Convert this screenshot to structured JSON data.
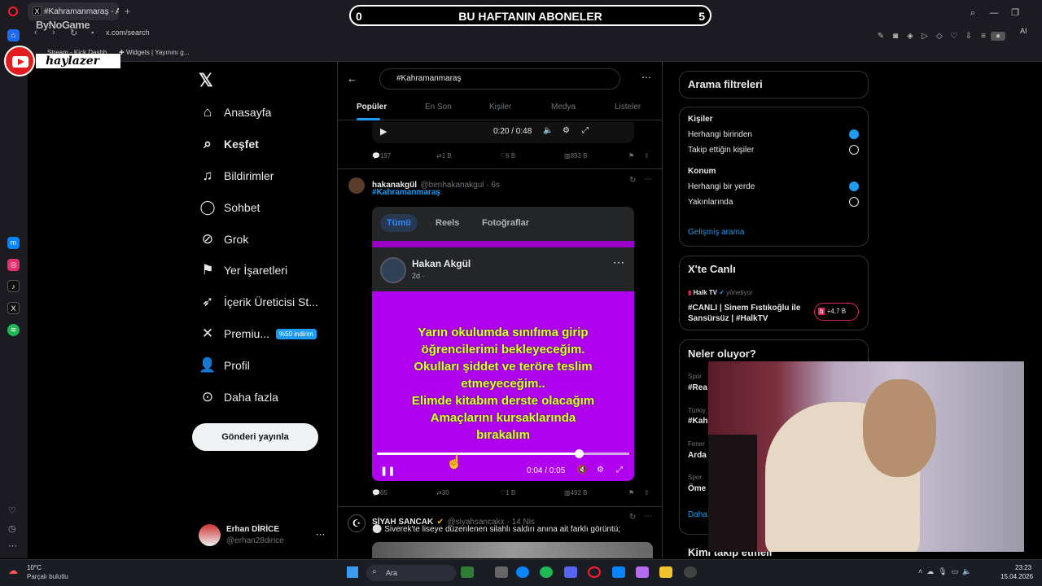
{
  "browser": {
    "tab_title": "#Kahramanmaraş - Arama",
    "new_tab": "+",
    "url": "x.com/search",
    "bookmarks": [
      "Stream - Kick Dashb...",
      "Widgets | Yayınını g..."
    ],
    "ai_label": "AI"
  },
  "overlay": {
    "sub_left": "0",
    "sub_title": "BU HAFTANIN ABONELER",
    "sub_right": "5",
    "brand": "ByNoGame",
    "channel": "haylazer"
  },
  "nav": {
    "items": [
      {
        "label": "Anasayfa",
        "icon": "home-icon"
      },
      {
        "label": "Keşfet",
        "icon": "search-icon"
      },
      {
        "label": "Bildirimler",
        "icon": "bell-icon"
      },
      {
        "label": "Sohbet",
        "icon": "chat-icon"
      },
      {
        "label": "Grok",
        "icon": "grok-icon"
      },
      {
        "label": "Yer İşaretleri",
        "icon": "bookmark-icon"
      },
      {
        "label": "İçerik Üreticisi St...",
        "icon": "rocket-icon"
      },
      {
        "label": "Premiu...",
        "icon": "x-icon"
      },
      {
        "label": "Profil",
        "icon": "profile-icon"
      },
      {
        "label": "Daha fazla",
        "icon": "more-icon"
      }
    ],
    "premium_badge": "%50 indirim",
    "post_button": "Gönderi yayınla",
    "account_name": "Erhan DİRİCE",
    "account_handle": "@erhan28dirice"
  },
  "search": {
    "query": "#Kahramanmaraş",
    "tabs": [
      "Popüler",
      "En Son",
      "Kişiler",
      "Medya",
      "Listeler"
    ]
  },
  "tweets": {
    "t0": {
      "time": "0:20 / 0:48",
      "replies": "197",
      "retweets": "1 B",
      "likes": "6 B",
      "views": "893 B"
    },
    "t1": {
      "name": "hakanakgül",
      "handle": "@benhakanakgul · 6s",
      "hashtag": "#Kahramanmaraş",
      "fb_tabs": [
        "Tümü",
        "Reels",
        "Fotoğraflar"
      ],
      "fb_name": "Hakan Akgül",
      "fb_meta": "2d ·",
      "overlay_lines": [
        "Yarın okulumda sınıfıma girip",
        "öğrencilerimi bekleyeceğim.",
        "Okulları şiddet ve teröre teslim",
        "etmeyeceğim..",
        "Elimde kitabım derste olacağım",
        "Amaçlarını kursaklarında",
        "bırakalım"
      ],
      "time": "0:04 / 0:05",
      "progress": 0.8,
      "replies": "65",
      "retweets": "30",
      "likes": "1 B",
      "views": "492 B"
    },
    "t2": {
      "name": "SİYAH SANCAK",
      "handle": "@siyahsancakx · 14 Nis",
      "text": "⚪ Siverek'te liseye düzenlenen silahlı saldırı anına ait farklı görüntü;"
    }
  },
  "filters": {
    "title": "Arama filtreleri",
    "people_heading": "Kişiler",
    "people_opts": [
      "Herhangi birinden",
      "Takip ettiğin kişiler"
    ],
    "location_heading": "Konum",
    "location_opts": [
      "Herhangi bir yerde",
      "Yakınlarında"
    ],
    "advanced": "Gelişmiş arama"
  },
  "live": {
    "title": "X'te Canlı",
    "source": "Halk TV",
    "role": "yönetiyor",
    "text": "#CANLI | Sinem Fıstıkoğlu ile Sansürsüz | #HalkTV",
    "count": "+4,7 B"
  },
  "trends": {
    "title": "Neler oluyor?",
    "items": [
      {
        "cat": "Spor",
        "name": "#Rea"
      },
      {
        "cat": "Türkiy",
        "name": "#Kah"
      },
      {
        "cat": "Fener",
        "name": "Arda"
      },
      {
        "cat": "Spor",
        "name": "Öme"
      }
    ],
    "more": "Daha",
    "follow_title": "Kimi takip etmeli"
  },
  "taskbar": {
    "weather_temp": "10°C",
    "weather_desc": "Parçalı bulutlu",
    "search": "Ara",
    "time": "23:23",
    "date": "15.04.2026"
  },
  "colors": {
    "accent": "#1d9bf0",
    "purple": "#b000f0",
    "overlay_text": "#d6ff2a"
  }
}
